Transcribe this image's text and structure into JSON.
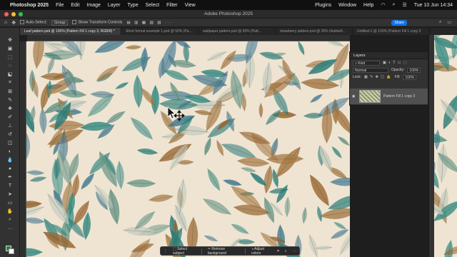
{
  "menubar": {
    "app_name": "Photoshop 2025",
    "items": [
      "File",
      "Edit",
      "Image",
      "Layer",
      "Type",
      "Select",
      "Filter",
      "View",
      "Plugins",
      "Window",
      "Help"
    ],
    "datetime": "Tue 10 Jun  14:34"
  },
  "window": {
    "title": "Adobe Photoshop 2025"
  },
  "options_bar": {
    "auto_select_label": "Auto-Select:",
    "auto_select_value": "Group",
    "show_transform_label": "Show Transform Controls",
    "share_label": "Share"
  },
  "tabs": [
    {
      "label": "Leaf pattern.psd @ 100% (Pattern Fill 1 copy 3, RGB/8) *",
      "active": true
    },
    {
      "label": "Short format example 1.psd @ 50% (Pa...",
      "active": false
    },
    {
      "label": "wallpaper pattern.psd @ 50% (Patt...",
      "active": false
    },
    {
      "label": "strawberry pattern.psd @ 25% (Adobefi...",
      "active": false
    },
    {
      "label": "Untitled-1 @ 100% (Pattern Fill 1 copy 3",
      "active": false
    }
  ],
  "layers_panel": {
    "title": "Layers",
    "filter_label": "Kind",
    "blend_mode": "Normal",
    "opacity_label": "Opacity:",
    "opacity_value": "100%",
    "lock_label": "Lock:",
    "fill_label": "Fill:",
    "fill_value": "100%",
    "layer_name": "Pattern Fill 1 copy 3"
  },
  "context_bar": {
    "select_subject": "Select subject",
    "remove_background": "Remove background",
    "adjust_colors": "Adjust colors"
  },
  "colors": {
    "foreground": "#2f7a4a",
    "background": "#ffffff",
    "accent": "#1473e6"
  }
}
